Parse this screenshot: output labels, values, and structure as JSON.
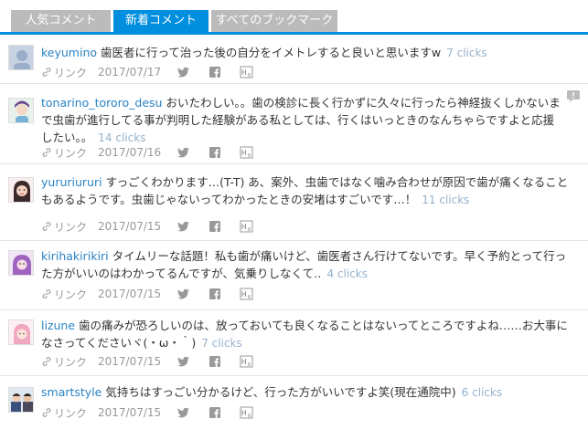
{
  "tabs": [
    {
      "label": "人気コメント"
    },
    {
      "label": "新着コメント"
    },
    {
      "label": "すべてのブックマーク"
    }
  ],
  "link_label": "リンク",
  "comments": [
    {
      "user": "keyumino",
      "text": "歯医者に行って治った後の自分をイメトレすると良いと思いますw",
      "clicks": "7 clicks",
      "date": "2017/07/17"
    },
    {
      "user": "tonarino_tororo_desu",
      "text": "おいたわしい。。歯の検診に長く行かずに久々に行ったら神経抜くしかないまで虫歯が進行してる事が判明した経験がある私としては、行くはいっときのなんちゃらですよと応援したい。。",
      "clicks": "14 clicks",
      "date": "2017/07/16"
    },
    {
      "user": "yururiururi",
      "text": "すっごくわかります…(T-T) あ、案外、虫歯ではなく噛み合わせが原因で歯が痛くなることもあるようです。虫歯じゃないってわかったときの安堵はすごいです…！",
      "clicks": "11 clicks",
      "date": "2017/07/15"
    },
    {
      "user": "kirihakirikiri",
      "text": "タイムリーな話題！私も歯が痛いけど、歯医者さん行けてないです。早く予約とって行った方がいいのはわかってるんですが、気乗りしなくて‥",
      "clicks": "4 clicks",
      "date": "2017/07/15"
    },
    {
      "user": "lizune",
      "text": "歯の痛みが恐ろしいのは、放っておいても良くなることはないってところですよね……お大事になさってくださいヾ(・ω・｀)",
      "clicks": "7 clicks",
      "date": "2017/07/15"
    },
    {
      "user": "smartstyle",
      "text": "気持ちはすっごい分かるけど、行った方がいいですよ笑(現在通院中)",
      "clicks": "6 clicks",
      "date": "2017/07/15"
    }
  ],
  "colors": {
    "accent": "#008fde",
    "user": "#2a83c5",
    "clicks": "#96b2cc",
    "tab_inactive": "#bbbbbb"
  }
}
